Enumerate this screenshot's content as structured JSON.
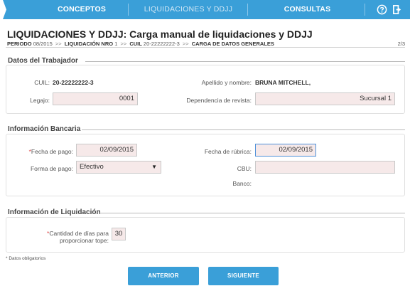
{
  "nav": {
    "items": [
      {
        "label": "CONCEPTOS"
      },
      {
        "label": "LIQUIDACIONES Y DDJJ"
      },
      {
        "label": "CONSULTAS"
      }
    ],
    "bg_color": "#3a9fd8",
    "icons": [
      "help-icon",
      "logout-icon"
    ]
  },
  "header": {
    "title": "LIQUIDACIONES Y DDJJ: Carga manual de liquidaciones y DDJJ",
    "breadcrumb": {
      "periodo_label": "PERIODO",
      "periodo_value": "08/2015",
      "liquidacion_label": "LIQUIDACIÓN NRO",
      "liquidacion_value": "1",
      "cuil_label": "CUIL",
      "cuil_value": "20-22222222-3",
      "step_label": "CARGA DE DATOS GENERALES"
    },
    "step_counter": "2/3"
  },
  "trabajador": {
    "section_title": "Datos del Trabajador",
    "cuil_label": "CUIL:",
    "cuil_value": "20-22222222-3",
    "nombre_label": "Apellido y nombre:",
    "nombre_value": "BRUNA MITCHELL,",
    "legajo_label": "Legajo:",
    "legajo_value": "0001",
    "dependencia_label": "Dependencia de revista:",
    "dependencia_value": "Sucursal 1"
  },
  "bancaria": {
    "section_title": "Información Bancaria",
    "fecha_pago_label": "Fecha de pago:",
    "fecha_pago_value": "02/09/2015",
    "fecha_rubrica_label": "Fecha de rúbrica:",
    "fecha_rubrica_value": "02/09/2015",
    "forma_pago_label": "Forma de pago:",
    "forma_pago_value": "Efectivo",
    "cbu_label": "CBU:",
    "cbu_value": "",
    "banco_label": "Banco:"
  },
  "liquidacion": {
    "section_title": "Información de Liquidación",
    "dias_label_line1": "Cantidad de días para",
    "dias_label_line2": "proporcionar tope:",
    "dias_value": "30"
  },
  "footnote": "Datos obligatorios",
  "buttons": {
    "anterior": "ANTERIOR",
    "siguiente": "SIGUIENTE"
  }
}
